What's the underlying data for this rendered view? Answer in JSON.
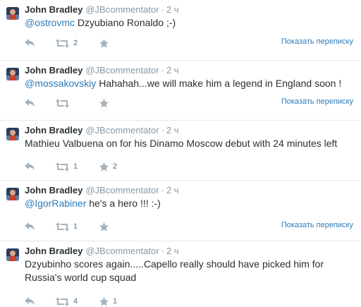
{
  "colors": {
    "link": "#2b7bb9",
    "name": "#292f33",
    "meta": "#8899a6",
    "icon": "#a5b2bc"
  },
  "icons": {
    "reply": "reply-arrow-icon",
    "retweet": "retweet-icon",
    "favorite": "star-icon"
  },
  "tweets": [
    {
      "fullname": "John Bradley",
      "username": "@JBcommentator",
      "sep": "·",
      "time": "2 ч",
      "mention": "@ostrovmc",
      "text": " Dzyubiano Ronaldo ;-)",
      "retweets": "2",
      "favorites": "",
      "conversation": "Показать переписку"
    },
    {
      "fullname": "John Bradley",
      "username": "@JBcommentator",
      "sep": "·",
      "time": "2 ч",
      "mention": "@mossakovskiy",
      "text": " Hahahah...we will make him a legend in England soon !",
      "retweets": "",
      "favorites": "",
      "conversation": "Показать переписку"
    },
    {
      "fullname": "John Bradley",
      "username": "@JBcommentator",
      "sep": "·",
      "time": "2 ч",
      "mention": "",
      "text": "Mathieu Valbuena on for his Dinamo Moscow debut with 24 minutes left",
      "retweets": "1",
      "favorites": "2",
      "conversation": ""
    },
    {
      "fullname": "John Bradley",
      "username": "@JBcommentator",
      "sep": "·",
      "time": "2 ч",
      "mention": "@IgorRabiner",
      "text": " he's a hero !!! :-)",
      "retweets": "1",
      "favorites": "",
      "conversation": "Показать переписку"
    },
    {
      "fullname": "John Bradley",
      "username": "@JBcommentator",
      "sep": "·",
      "time": "2 ч",
      "mention": "",
      "text": "Dzyubinho scores again.....Capello really should have picked him for Russia's world cup squad",
      "retweets": "4",
      "favorites": "1",
      "conversation": ""
    }
  ]
}
